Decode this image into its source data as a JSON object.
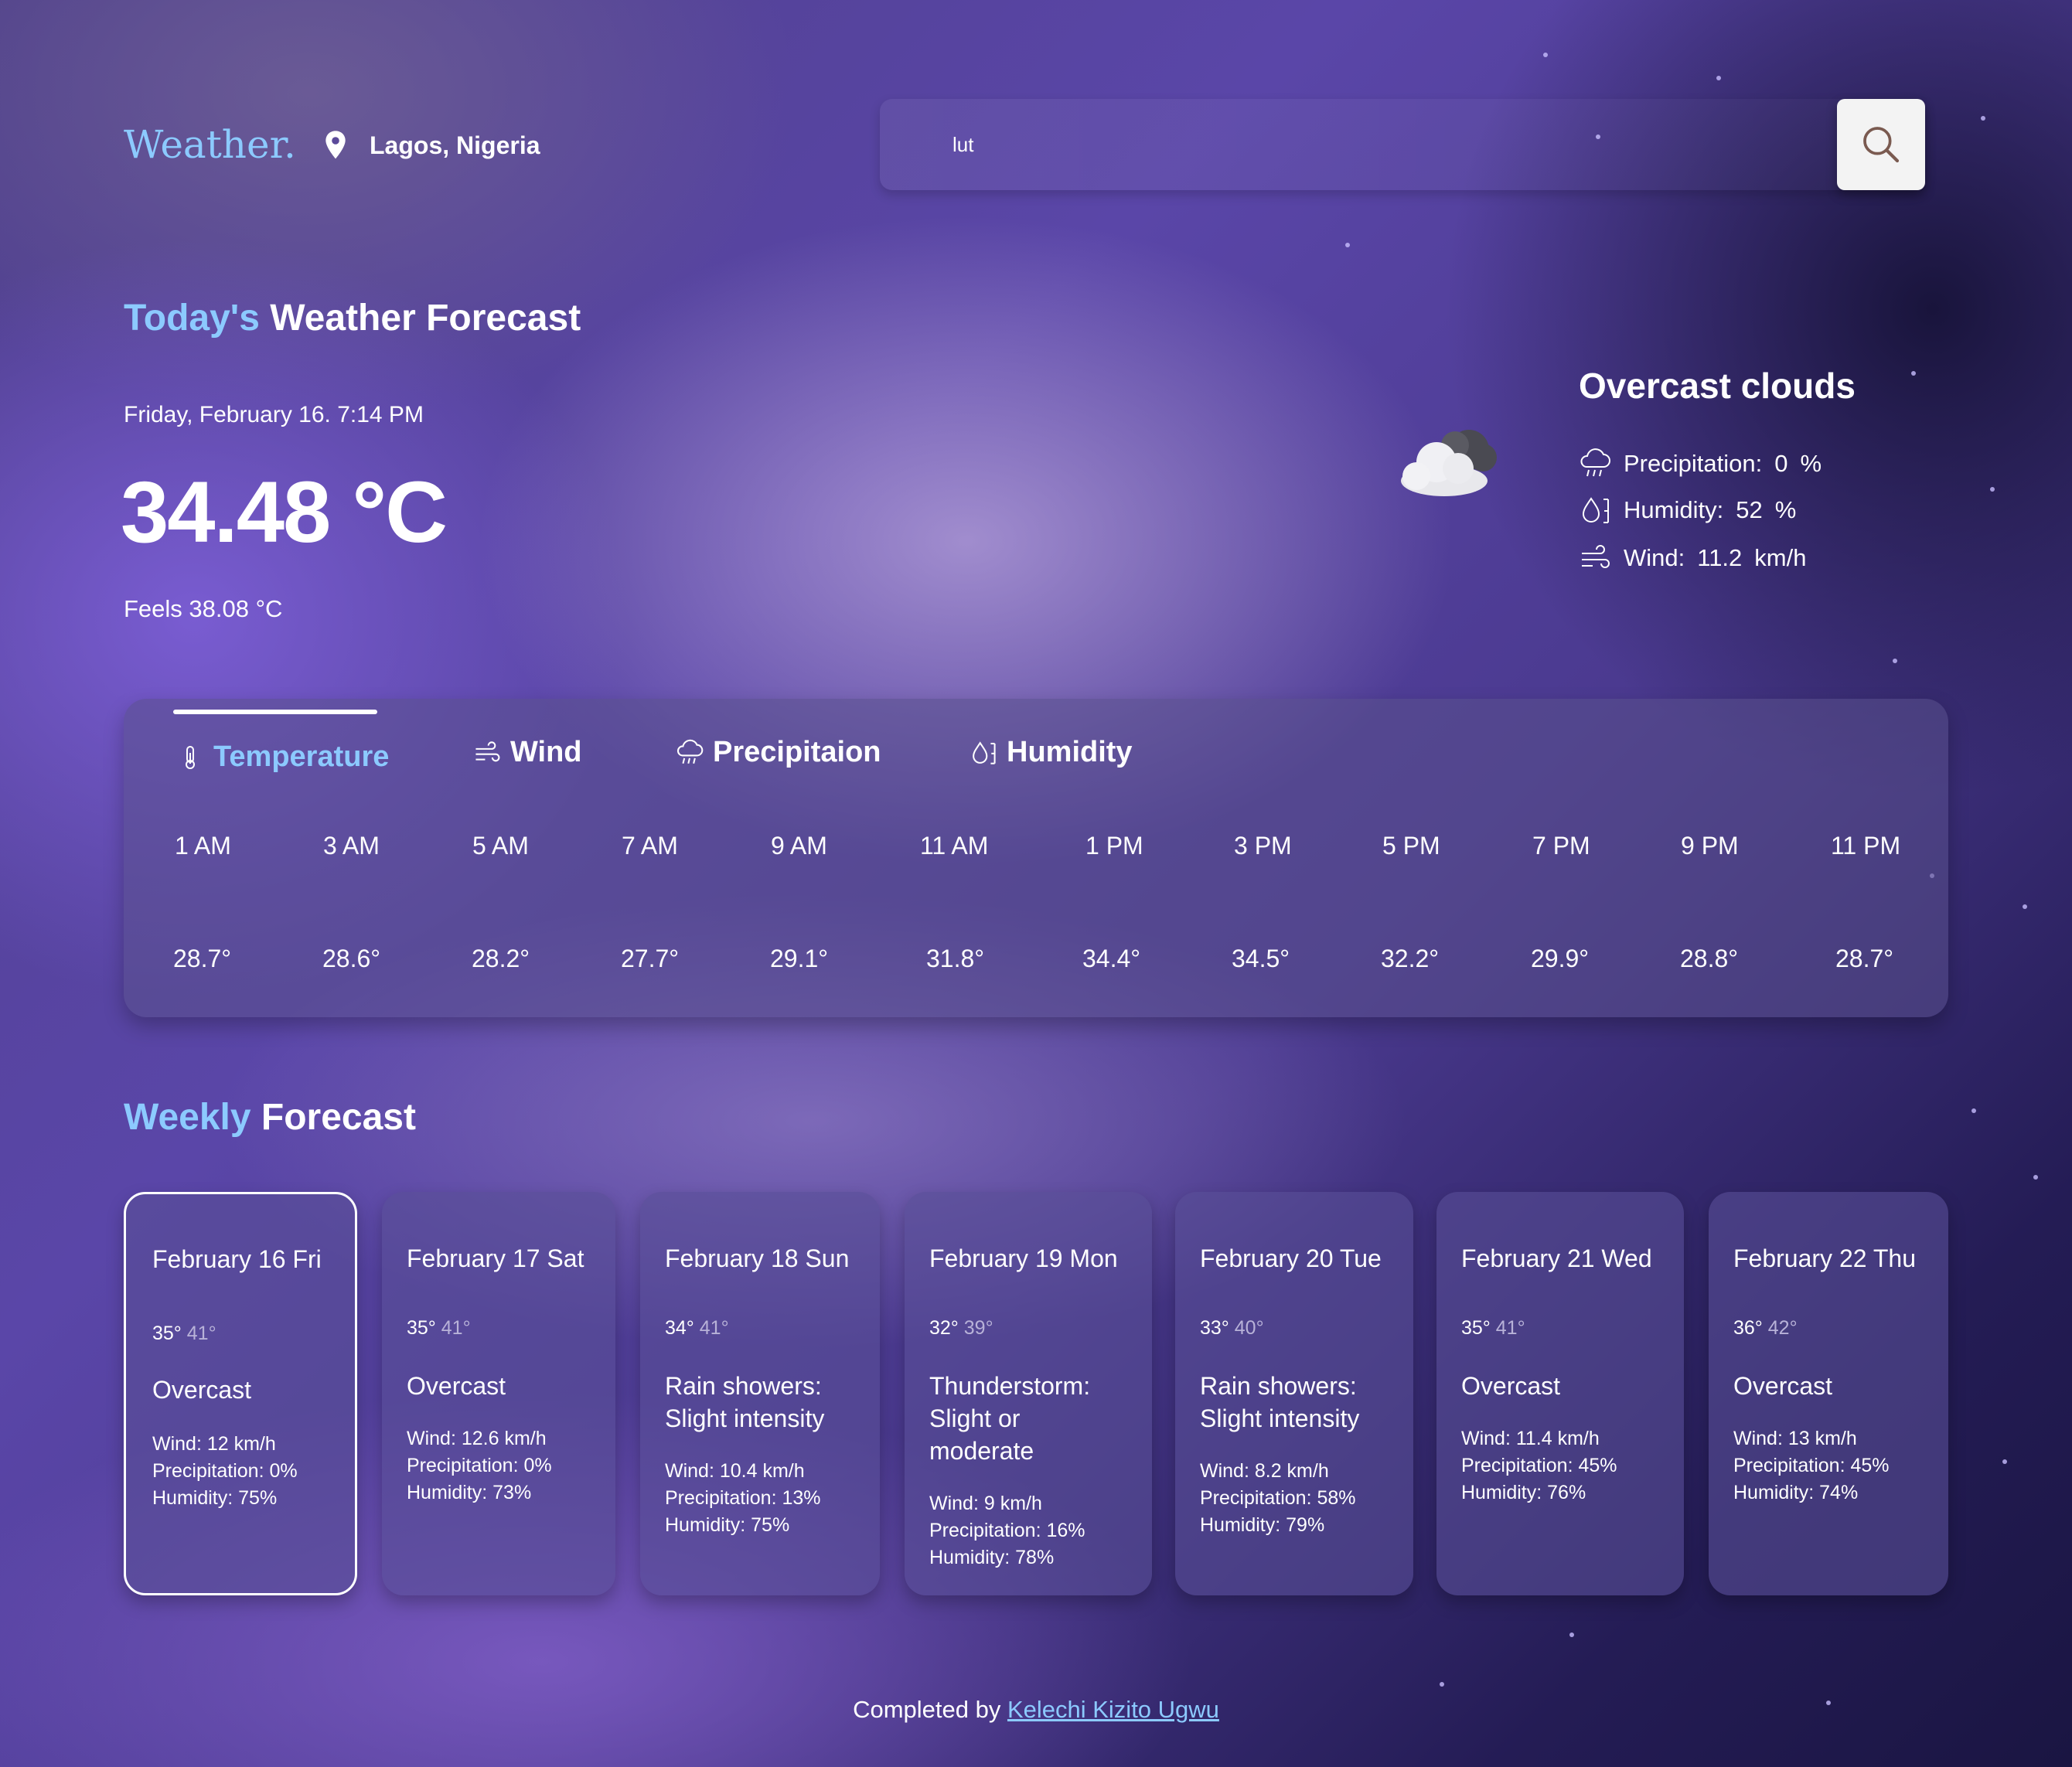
{
  "header": {
    "logo": "Weather.",
    "location": "Lagos, Nigeria",
    "search_value": "lut"
  },
  "today": {
    "title_accent": "Today's",
    "title_rest": " Weather Forecast",
    "datetime": "Friday, February 16. 7:14 PM",
    "temperature": "34.48 °C",
    "feels": "Feels 38.08 °C",
    "condition": "Overcast clouds",
    "icon": "cloud-icon",
    "precipitation_label": "Precipitation:",
    "precipitation_value": "0",
    "precipitation_unit": "%",
    "humidity_label": "Humidity:",
    "humidity_value": "52",
    "humidity_unit": "%",
    "wind_label": "Wind:",
    "wind_value": "11.2",
    "wind_unit": "km/h"
  },
  "hourly": {
    "tabs": [
      {
        "label": "Temperature",
        "icon": "thermometer-icon"
      },
      {
        "label": "Wind",
        "icon": "wind-icon"
      },
      {
        "label": "Precipitaion",
        "icon": "rain-cloud-icon"
      },
      {
        "label": "Humidity",
        "icon": "humidity-icon"
      }
    ],
    "active_tab": 0,
    "hours": [
      {
        "time": "1 AM",
        "value": "28.7°"
      },
      {
        "time": "3 AM",
        "value": "28.6°"
      },
      {
        "time": "5 AM",
        "value": "28.2°"
      },
      {
        "time": "7 AM",
        "value": "27.7°"
      },
      {
        "time": "9 AM",
        "value": "29.1°"
      },
      {
        "time": "11 AM",
        "value": "31.8°"
      },
      {
        "time": "1 PM",
        "value": "34.4°"
      },
      {
        "time": "3 PM",
        "value": "34.5°"
      },
      {
        "time": "5 PM",
        "value": "32.2°"
      },
      {
        "time": "7 PM",
        "value": "29.9°"
      },
      {
        "time": "9 PM",
        "value": "28.8°"
      },
      {
        "time": "11 PM",
        "value": "28.7°"
      }
    ]
  },
  "weekly": {
    "title_accent": "Weekly",
    "title_rest": " Forecast",
    "days": [
      {
        "date": "February 16  Fri",
        "low": "35°",
        "high": "41°",
        "condition": "Overcast",
        "wind": "Wind: 12 km/h",
        "precipitation": "Precipitation: 0%",
        "humidity": "Humidity: 75%"
      },
      {
        "date": "February 17  Sat",
        "low": "35°",
        "high": "41°",
        "condition": "Overcast",
        "wind": "Wind: 12.6 km/h",
        "precipitation": "Precipitation: 0%",
        "humidity": "Humidity: 73%"
      },
      {
        "date": "February 18  Sun",
        "low": "34°",
        "high": "41°",
        "condition": "Rain showers: Slight intensity",
        "wind": "Wind: 10.4 km/h",
        "precipitation": "Precipitation: 13%",
        "humidity": "Humidity: 75%"
      },
      {
        "date": "February 19  Mon",
        "low": "32°",
        "high": "39°",
        "condition": "Thunderstorm: Slight or moderate",
        "wind": "Wind: 9 km/h",
        "precipitation": "Precipitation: 16%",
        "humidity": "Humidity: 78%"
      },
      {
        "date": "February 20  Tue",
        "low": "33°",
        "high": "40°",
        "condition": "Rain showers: Slight intensity",
        "wind": "Wind: 8.2 km/h",
        "precipitation": "Precipitation: 58%",
        "humidity": "Humidity: 79%"
      },
      {
        "date": "February 21  Wed",
        "low": "35°",
        "high": "41°",
        "condition": "Overcast",
        "wind": "Wind: 11.4 km/h",
        "precipitation": "Precipitation: 45%",
        "humidity": "Humidity: 76%"
      },
      {
        "date": "February 22  Thu",
        "low": "36°",
        "high": "42°",
        "condition": "Overcast",
        "wind": "Wind: 13 km/h",
        "precipitation": "Precipitation: 45%",
        "humidity": "Humidity: 74%"
      }
    ]
  },
  "footer": {
    "prefix": "Completed by ",
    "author": "Kelechi Kizito Ugwu"
  },
  "colors": {
    "accent": "#8ccaff",
    "text": "#ffffff",
    "panel": "rgba(90,80,140,0.55)"
  }
}
